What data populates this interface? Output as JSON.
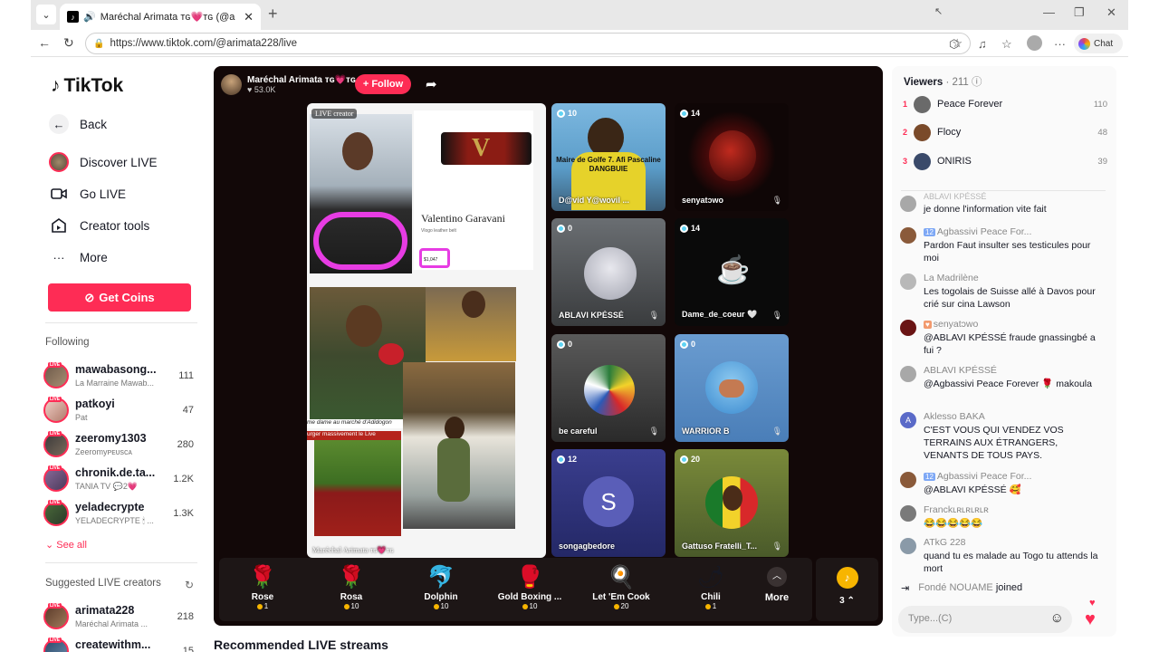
{
  "browser": {
    "tab_title": "Maréchal Arimata ᴛɢ💗ᴛɢ (@a",
    "url": "https://www.tiktok.com/@arimata228/live",
    "chat_label": "Chat"
  },
  "sidebar": {
    "logo": "TikTok",
    "back": "Back",
    "nav": [
      {
        "label": "Discover LIVE",
        "icon": "avatar-icon"
      },
      {
        "label": "Go LIVE",
        "icon": "camera-icon"
      },
      {
        "label": "Creator tools",
        "icon": "creator-icon"
      },
      {
        "label": "More",
        "icon": "ellipsis-icon"
      }
    ],
    "get_coins": "Get Coins",
    "following_title": "Following",
    "following": [
      {
        "name": "mawabasong...",
        "sub": "La Marraine Mawab...",
        "count": "111"
      },
      {
        "name": "patkoyi",
        "sub": "Pat",
        "count": "47"
      },
      {
        "name": "zeeromy1303",
        "sub": "Zeeromyᴘᴇᴜsᴄᴀ",
        "count": "280"
      },
      {
        "name": "chronik.de.ta...",
        "sub": "TANIA TV 💬2💗",
        "count": "1.2K"
      },
      {
        "name": "yeladecrypte",
        "sub": "YELADECRYPTE 🕯 ...",
        "count": "1.3K"
      }
    ],
    "see_all": "See all",
    "suggested_title": "Suggested LIVE creators",
    "suggested": [
      {
        "name": "arimata228",
        "sub": "Maréchal Arimata ...",
        "count": "218"
      },
      {
        "name": "createwithm...",
        "sub": "",
        "count": "15"
      }
    ],
    "live_badge": "LIVE"
  },
  "player": {
    "host_name": "Maréchal Arimata ᴛɢ💗ᴛɢ",
    "host_likes": "♥ 53.0K",
    "follow": "+ Follow",
    "main_tag": "LIVE creator",
    "main_name": "Maréchal Arimata ᴛɢ💗ᴛɢ",
    "belt_brand": "Valentino Garavani",
    "belt_sub": "Vlogo leather belt",
    "belt_price": "$1,047",
    "caption1": "me dame au marché d'Adidogon",
    "caption2": "urger massivement le Live",
    "guests": [
      {
        "name": "D@vid Y@wovil ...",
        "count": "10",
        "overlay": "Maire de Golfe 7. Afi Pascaline DANGBUIE"
      },
      {
        "name": "senyatɔwo",
        "count": "14"
      },
      {
        "name": "ABLAVI KPÉSSÉ",
        "count": "0"
      },
      {
        "name": "Dame_de_coeur 🤍",
        "count": "14"
      },
      {
        "name": "be careful",
        "count": "0"
      },
      {
        "name": "WARRIOR B",
        "count": "0"
      },
      {
        "name": "songagbedore",
        "count": "12",
        "initial": "S"
      },
      {
        "name": "Gattuso Fratelli_T...",
        "count": "20"
      }
    ],
    "gifts": [
      {
        "name": "Rose",
        "price": "1",
        "icon": "🌹"
      },
      {
        "name": "Rosa",
        "price": "10",
        "icon": "🌹"
      },
      {
        "name": "Dolphin",
        "price": "10",
        "icon": "🐬"
      },
      {
        "name": "Gold Boxing ...",
        "price": "10",
        "icon": "🥊"
      },
      {
        "name": "Let 'Em Cook",
        "price": "20",
        "icon": "🍳"
      },
      {
        "name": "Chili",
        "price": "1",
        "icon": "🌶"
      }
    ],
    "more": "More",
    "coins_count": "3"
  },
  "viewers": {
    "title": "Viewers",
    "count": "· 211",
    "top": [
      {
        "rank": "1",
        "name": "Peace Forever",
        "score": "110",
        "color": "#6a6a6a"
      },
      {
        "rank": "2",
        "name": "Flocy",
        "score": "48",
        "color": "#7a4a2a"
      },
      {
        "rank": "3",
        "name": "ONIRIS",
        "score": "39",
        "color": "#3a4a6a"
      }
    ]
  },
  "chat": [
    {
      "name": "ABLAVI KPÉSSÉ",
      "text": "je donne l'information vite fait",
      "color": "#a8a8a8"
    },
    {
      "name": "Agbassivi Peace For...",
      "level": "12",
      "text": "Pardon Faut insulter ses testicules pour moi",
      "color": "#8a5a3a"
    },
    {
      "name": "La Madrilène",
      "text": "Les togolais de Suisse allé à Davos pour crié sur cina Lawson",
      "color": "#b8b8b8"
    },
    {
      "name": "senyatɔwo",
      "level": "",
      "text": "@ABLAVI KPÉSSÉ fraude gnassingbé a fui ?",
      "color": "#6a1414"
    },
    {
      "name": "ABLAVI KPÉSSÉ",
      "text": "@Agbassivi Peace Forever 🌹 makoula",
      "color": "#a8a8a8"
    },
    {
      "name": "Aklesso BAKA",
      "text": "C'EST VOUS QUI VENDEZ VOS TERRAINS AUX ÉTRANGERS, VENANTS DE TOUS PAYS.",
      "color": "#5a6ac8",
      "initial": "A"
    },
    {
      "name": "Agbassivi Peace For...",
      "level": "12",
      "text": "@ABLAVI KPÉSSÉ 🥰",
      "color": "#8a5a3a"
    },
    {
      "name": "Franckʟʀʟʀʟʀʟʀ",
      "text": "😂😂😂😂😂",
      "color": "#7a7a7a"
    },
    {
      "name": "ATkG 228",
      "text": "quand tu es malade au Togo tu attends la mort",
      "color": "#8a9aa8"
    }
  ],
  "joined": {
    "name": "Fondé NOUAME",
    "text": "joined"
  },
  "chat_input": {
    "placeholder": "Type...(C)"
  },
  "recommended": "Recommended LIVE streams"
}
